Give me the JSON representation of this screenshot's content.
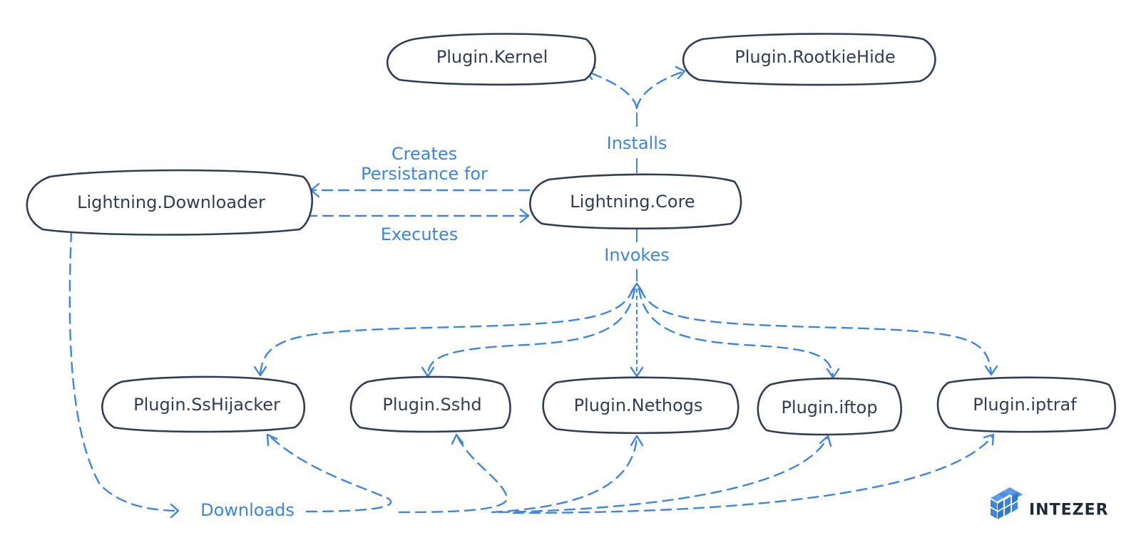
{
  "diagram": {
    "nodes": [
      {
        "id": "plugin_kernel",
        "label": "Plugin.Kernel"
      },
      {
        "id": "plugin_rootkiehide",
        "label": "Plugin.RootkieHide"
      },
      {
        "id": "lightning_downloader",
        "label": "Lightning.Downloader"
      },
      {
        "id": "lightning_core",
        "label": "Lightning.Core"
      },
      {
        "id": "plugin_sshijacker",
        "label": "Plugin.SsHijacker"
      },
      {
        "id": "plugin_sshd",
        "label": "Plugin.Sshd"
      },
      {
        "id": "plugin_nethogs",
        "label": "Plugin.Nethogs"
      },
      {
        "id": "plugin_iftop",
        "label": "Plugin.iftop"
      },
      {
        "id": "plugin_iptraf",
        "label": "Plugin.iptraf"
      }
    ],
    "edge_labels": {
      "installs": "Installs",
      "creates_line1": "Creates",
      "creates_line2": "Persistance for",
      "executes": "Executes",
      "invokes": "Invokes",
      "downloads": "Downloads"
    },
    "edges": [
      {
        "from": "lightning_core",
        "to": "plugin_kernel",
        "label": "Installs"
      },
      {
        "from": "lightning_core",
        "to": "plugin_rootkiehide",
        "label": "Installs"
      },
      {
        "from": "lightning_core",
        "to": "lightning_downloader",
        "label": "Creates Persistance for"
      },
      {
        "from": "lightning_downloader",
        "to": "lightning_core",
        "label": "Executes"
      },
      {
        "from": "lightning_core",
        "to": "plugin_sshijacker",
        "label": "Invokes"
      },
      {
        "from": "lightning_core",
        "to": "plugin_sshd",
        "label": "Invokes"
      },
      {
        "from": "lightning_core",
        "to": "plugin_nethogs",
        "label": "Invokes"
      },
      {
        "from": "lightning_core",
        "to": "plugin_iftop",
        "label": "Invokes"
      },
      {
        "from": "lightning_core",
        "to": "plugin_iptraf",
        "label": "Invokes"
      },
      {
        "from": "lightning_downloader",
        "to": "plugin_sshijacker",
        "label": "Downloads"
      },
      {
        "from": "lightning_downloader",
        "to": "plugin_sshd",
        "label": "Downloads"
      },
      {
        "from": "lightning_downloader",
        "to": "plugin_nethogs",
        "label": "Downloads"
      },
      {
        "from": "lightning_downloader",
        "to": "plugin_iftop",
        "label": "Downloads"
      },
      {
        "from": "lightning_downloader",
        "to": "plugin_iptraf",
        "label": "Downloads"
      }
    ],
    "colors": {
      "node_stroke": "#2f3e55",
      "edge": "#3d86dc",
      "logo_blue": "#3d86dc"
    }
  },
  "logo": {
    "icon": "cube-icon",
    "text": "INTEZER"
  }
}
